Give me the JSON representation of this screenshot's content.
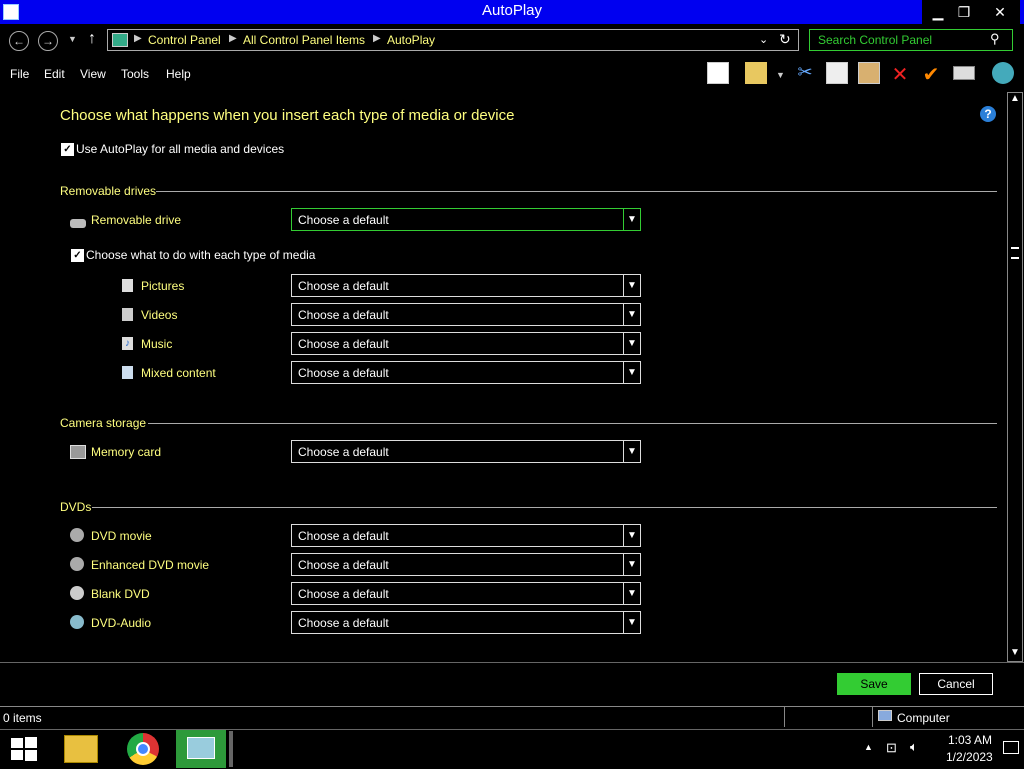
{
  "window": {
    "title": "AutoPlay",
    "minimize": "▁",
    "restore": "❐",
    "close": "✕"
  },
  "address": {
    "breadcrumbs": [
      "Control Panel",
      "All Control Panel Items",
      "AutoPlay"
    ],
    "search_placeholder": "Search Control Panel"
  },
  "menu": [
    "File",
    "Edit",
    "View",
    "Tools",
    "Help"
  ],
  "toolbar_icons": [
    "layout-icon",
    "properties-icon",
    "cut-icon",
    "copy-icon",
    "paste-icon",
    "delete-icon",
    "check-icon",
    "rename-icon",
    "globe-icon"
  ],
  "heading": "Choose what happens when you insert each type of media or device",
  "use_autoplay": {
    "label": "Use AutoPlay for all media and devices",
    "checked": true
  },
  "sections": {
    "removable": {
      "title": "Removable drives"
    },
    "camera": {
      "title": "Camera storage"
    },
    "dvds": {
      "title": "DVDs"
    }
  },
  "removable_drive": {
    "label": "Removable drive",
    "value": "Choose a default"
  },
  "media_each": {
    "label": "Choose what to do with each type of media",
    "checked": true
  },
  "media_types": [
    {
      "label": "Pictures",
      "value": "Choose a default",
      "icon": "pictures-icon"
    },
    {
      "label": "Videos",
      "value": "Choose a default",
      "icon": "videos-icon"
    },
    {
      "label": "Music",
      "value": "Choose a default",
      "icon": "music-icon"
    },
    {
      "label": "Mixed content",
      "value": "Choose a default",
      "icon": "mixed-content-icon"
    }
  ],
  "memory_card": {
    "label": "Memory card",
    "value": "Choose a default"
  },
  "dvd_items": [
    {
      "label": "DVD movie",
      "value": "Choose a default"
    },
    {
      "label": "Enhanced DVD movie",
      "value": "Choose a default"
    },
    {
      "label": "Blank DVD",
      "value": "Choose a default"
    },
    {
      "label": "DVD-Audio",
      "value": "Choose a default"
    }
  ],
  "buttons": {
    "save": "Save",
    "cancel": "Cancel"
  },
  "status": {
    "items": "0 items",
    "location": "Computer"
  },
  "clock": {
    "time": "1:03 AM",
    "date": "1/2/2023"
  },
  "colors": {
    "title_bar": "#0000f0",
    "link_yellow": "#ffff80",
    "accent_green": "#33cc33"
  }
}
